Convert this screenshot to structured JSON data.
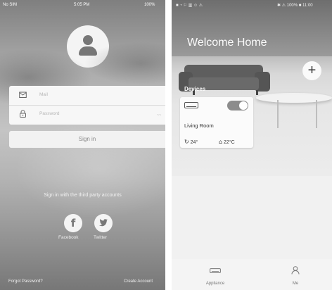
{
  "login_screen": {
    "status": {
      "carrier": "No SIM",
      "time": "5:05 PM",
      "battery": "100%"
    },
    "mail_placeholder": "Mail",
    "password_placeholder": "Password",
    "password_eye": "~~",
    "signin_label": "Sign in",
    "third_party_text": "Sign in with the third party accounts",
    "facebook_label": "Facebook",
    "twitter_label": "Twitter",
    "forgot_password": "Forgot Password?",
    "create_account": "Create Account",
    "icons": {
      "facebook": "f",
      "twitter": "t"
    }
  },
  "home_screen": {
    "status": {
      "icons": "■ ◔ ⚐ ▥ ☺ ⚠",
      "right": "✱ ⚠ 100% ■ 11:00"
    },
    "welcome_title": "Welcome Home",
    "add_label": "+",
    "devices_heading": "Devices",
    "device": {
      "name": "Living Room",
      "indoor_temp": "24°",
      "indoor_icon": "↻",
      "set_temp": "22°C",
      "set_icon": "⌂",
      "power_on": true
    },
    "tabs": [
      {
        "label": "Appliance"
      },
      {
        "label": "Me"
      }
    ]
  }
}
